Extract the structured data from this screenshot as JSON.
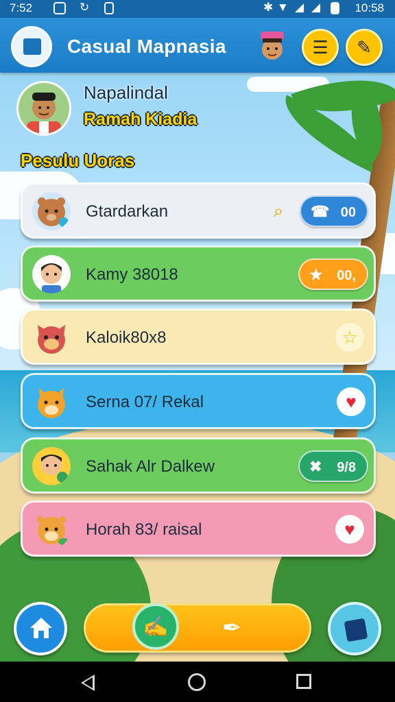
{
  "status_bar": {
    "time": "7:52",
    "clock": "10:58"
  },
  "app": {
    "title": "Casual Mapnasia",
    "logo_icon": "chat-book-icon",
    "menu_icon": "hamburger-menu-icon",
    "edit_icon": "pencil-icon"
  },
  "profile": {
    "name": "Napalindal",
    "subtitle": "Ramah Kiadia"
  },
  "section": {
    "title": "Pesulu Uoras"
  },
  "contacts": [
    {
      "name": "Gtardarkan",
      "card_color": "#eceff3",
      "action": "call",
      "action_icon": "phone-icon",
      "action_value": "00",
      "action_color": "#2f86d8",
      "extra_icon": "magnifier-icon"
    },
    {
      "name": "Kamy 38018",
      "card_color": "#6ccd5e",
      "action": "favorite",
      "action_icon": "star-icon",
      "action_value": "00,",
      "action_color": "#ff9f1a"
    },
    {
      "name": "Kaloik80x8",
      "card_color": "#fbe9b4",
      "action": "star",
      "action_icon": "star-icon"
    },
    {
      "name": "Serna 07/ Rekal",
      "card_color": "#3eb4ec",
      "action": "heart",
      "action_icon": "heart-icon"
    },
    {
      "name": "Sahak Alr Dalkew",
      "card_color": "#6ccd5e",
      "action": "dismiss",
      "action_icon": "close-x-icon",
      "action_value": "9/8",
      "action_color": "#27a66b"
    },
    {
      "name": "Horah 83/ raisal",
      "card_color": "#f49ab4",
      "action": "heart",
      "action_icon": "heart-icon"
    }
  ],
  "bottom": {
    "home_icon": "house-icon",
    "compose_icon": "compose-note-icon",
    "pen_icon": "pen-nib-icon",
    "gallery_icon": "photo-card-icon"
  },
  "colors": {
    "primary": "#1a7cc6",
    "accent": "#ffc400",
    "title_yellow": "#ffd400"
  }
}
